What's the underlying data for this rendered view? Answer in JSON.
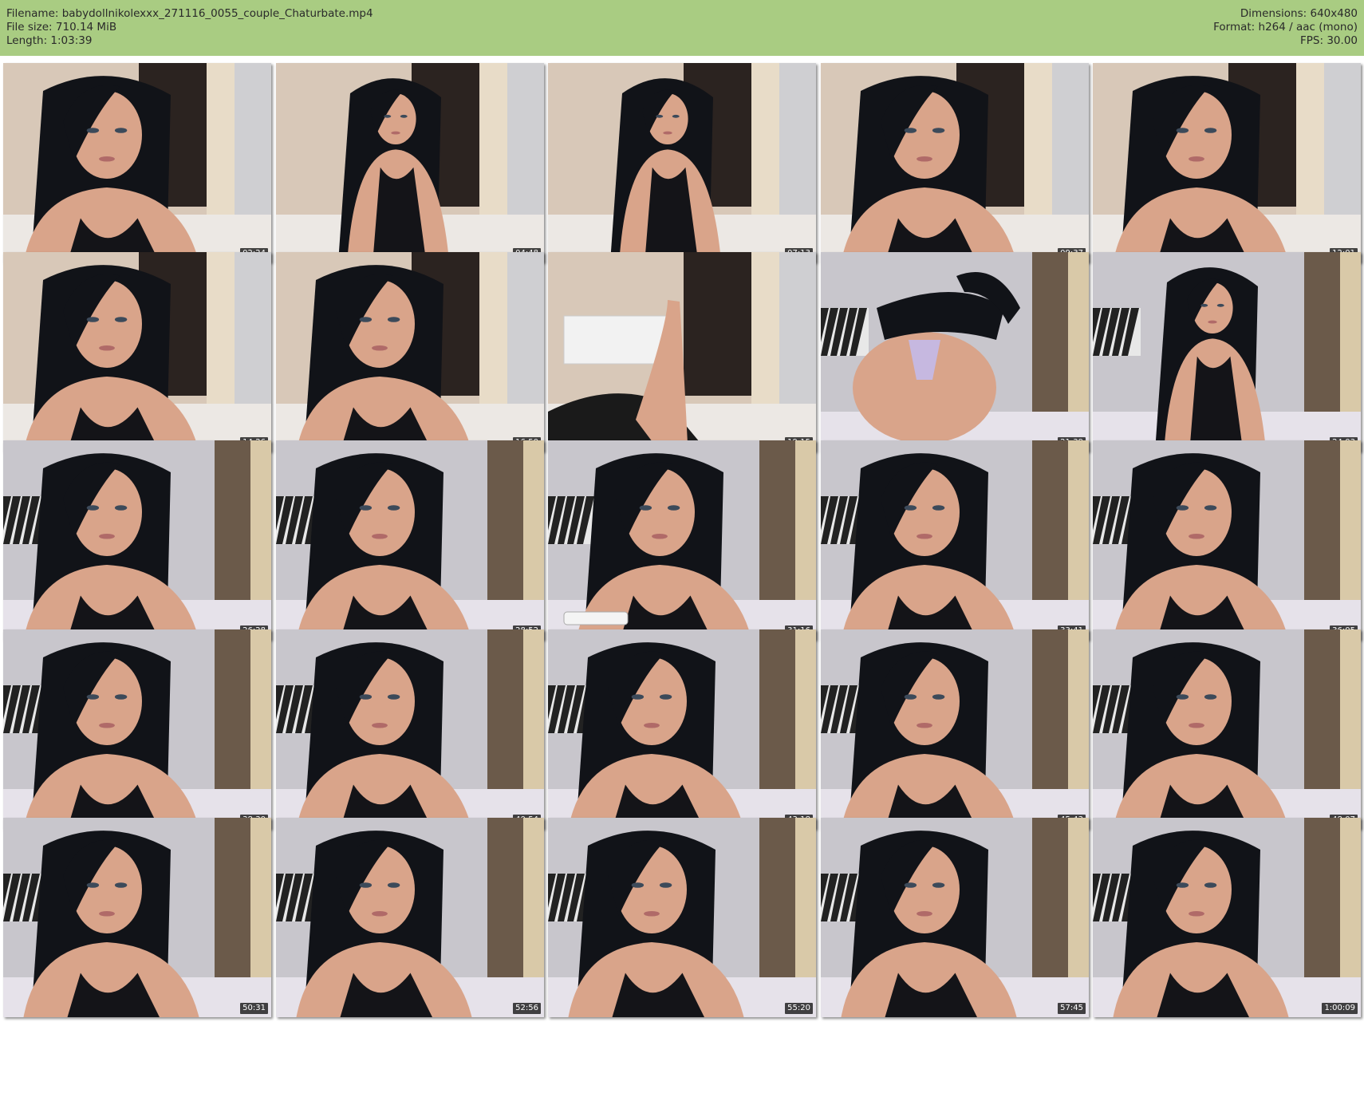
{
  "header": {
    "filename": "Filename: babydollnikolexxx_271116_0055_couple_Chaturbate.mp4",
    "filesize": "File size: 710.14 MiB",
    "length": "Length: 1:03:39",
    "dimensions": "Dimensions: 640x480",
    "format": "Format: h264 / aac (mono)",
    "fps": "FPS: 30.00"
  },
  "colors": {
    "header_bg": "#a9cc82",
    "skin": "#d9a48a",
    "hair": "#111318",
    "wall": "#c9c5c8"
  },
  "thumbnails": [
    {
      "time": "02:24",
      "scene": "closeup-dark-door"
    },
    {
      "time": "04:48",
      "scene": "standing-white-room"
    },
    {
      "time": "07:13",
      "scene": "sitting-full"
    },
    {
      "time": "09:37",
      "scene": "closeup-dark-door"
    },
    {
      "time": "12:01",
      "scene": "closeup-dark-door"
    },
    {
      "time": "14:26",
      "scene": "closeup-dark-door"
    },
    {
      "time": "16:50",
      "scene": "closeup-dark-door"
    },
    {
      "time": "19:15",
      "scene": "legs-white-room"
    },
    {
      "time": "21:39",
      "scene": "back-grey-room"
    },
    {
      "time": "24:03",
      "scene": "sitting-grey-room"
    },
    {
      "time": "26:28",
      "scene": "closeup-grey-room"
    },
    {
      "time": "28:52",
      "scene": "closeup-grey-room"
    },
    {
      "time": "31:16",
      "scene": "phone-grey-room"
    },
    {
      "time": "33:41",
      "scene": "closeup-grey-room"
    },
    {
      "time": "36:05",
      "scene": "closeup-grey-room"
    },
    {
      "time": "38:30",
      "scene": "closeup-grey-room"
    },
    {
      "time": "40:54",
      "scene": "closeup-grey-room"
    },
    {
      "time": "43:18",
      "scene": "closeup-grey-room"
    },
    {
      "time": "45:43",
      "scene": "closeup-grey-room"
    },
    {
      "time": "48:07",
      "scene": "closeup-grey-room"
    },
    {
      "time": "50:31",
      "scene": "closeup-grey-room"
    },
    {
      "time": "52:56",
      "scene": "closeup-grey-room"
    },
    {
      "time": "55:20",
      "scene": "leaning-grey-room"
    },
    {
      "time": "57:45",
      "scene": "closeup-grey-room"
    },
    {
      "time": "1:00:09",
      "scene": "closeup-grey-room"
    }
  ]
}
